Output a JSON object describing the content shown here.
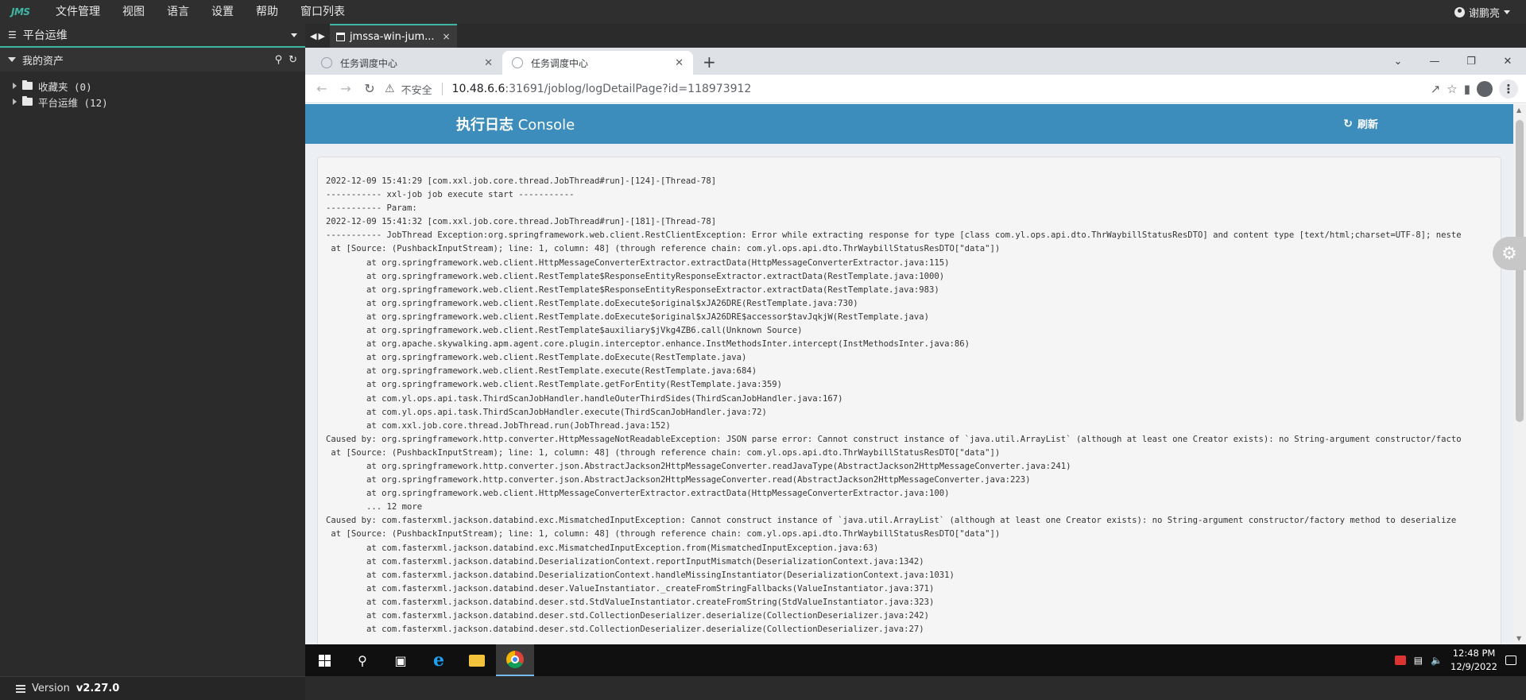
{
  "jms": {
    "logo": "JMS",
    "menu": [
      "文件管理",
      "视图",
      "语言",
      "设置",
      "帮助",
      "窗口列表"
    ],
    "user": "谢鹏亮"
  },
  "left_panel": {
    "header": "平台运维",
    "assets_title": "我的资产",
    "tree": [
      {
        "label": "收藏夹 (0)"
      },
      {
        "label": "平台运维 (12)"
      }
    ],
    "version_label": "Version",
    "version": "v2.27.0"
  },
  "session": {
    "tab_label": "jmssa-win-jum...",
    "close": "×"
  },
  "chrome": {
    "tabs": [
      {
        "title": "任务调度中心",
        "active": false
      },
      {
        "title": "任务调度中心",
        "active": true
      }
    ],
    "new_tab": "+",
    "security_text": "不安全",
    "url_host": "10.48.6.6",
    "url_path": ":31691/joblog/logDetailPage?id=118973912"
  },
  "page": {
    "title_bold": "执行日志",
    "title_rest": " Console",
    "refresh_label": "刷新",
    "log_lines": [
      "2022-12-09 15:41:29 [com.xxl.job.core.thread.JobThread#run]-[124]-[Thread-78]",
      "----------- xxl-job job execute start -----------",
      "----------- Param:",
      "2022-12-09 15:41:32 [com.xxl.job.core.thread.JobThread#run]-[181]-[Thread-78]",
      "----------- JobThread Exception:org.springframework.web.client.RestClientException: Error while extracting response for type [class com.yl.ops.api.dto.ThrWaybillStatusResDTO] and content type [text/html;charset=UTF-8]; neste",
      " at [Source: (PushbackInputStream); line: 1, column: 48] (through reference chain: com.yl.ops.api.dto.ThrWaybillStatusResDTO[\"data\"])",
      "        at org.springframework.web.client.HttpMessageConverterExtractor.extractData(HttpMessageConverterExtractor.java:115)",
      "        at org.springframework.web.client.RestTemplate$ResponseEntityResponseExtractor.extractData(RestTemplate.java:1000)",
      "        at org.springframework.web.client.RestTemplate$ResponseEntityResponseExtractor.extractData(RestTemplate.java:983)",
      "        at org.springframework.web.client.RestTemplate.doExecute$original$xJA26DRE(RestTemplate.java:730)",
      "        at org.springframework.web.client.RestTemplate.doExecute$original$xJA26DRE$accessor$tavJqkjW(RestTemplate.java)",
      "        at org.springframework.web.client.RestTemplate$auxiliary$jVkg4ZB6.call(Unknown Source)",
      "        at org.apache.skywalking.apm.agent.core.plugin.interceptor.enhance.InstMethodsInter.intercept(InstMethodsInter.java:86)",
      "        at org.springframework.web.client.RestTemplate.doExecute(RestTemplate.java)",
      "        at org.springframework.web.client.RestTemplate.execute(RestTemplate.java:684)",
      "        at org.springframework.web.client.RestTemplate.getForEntity(RestTemplate.java:359)",
      "        at com.yl.ops.api.task.ThirdScanJobHandler.handleOuterThirdSides(ThirdScanJobHandler.java:167)",
      "        at com.yl.ops.api.task.ThirdScanJobHandler.execute(ThirdScanJobHandler.java:72)",
      "        at com.xxl.job.core.thread.JobThread.run(JobThread.java:152)",
      "Caused by: org.springframework.http.converter.HttpMessageNotReadableException: JSON parse error: Cannot construct instance of `java.util.ArrayList` (although at least one Creator exists): no String-argument constructor/facto",
      " at [Source: (PushbackInputStream); line: 1, column: 48] (through reference chain: com.yl.ops.api.dto.ThrWaybillStatusResDTO[\"data\"])",
      "        at org.springframework.http.converter.json.AbstractJackson2HttpMessageConverter.readJavaType(AbstractJackson2HttpMessageConverter.java:241)",
      "        at org.springframework.http.converter.json.AbstractJackson2HttpMessageConverter.read(AbstractJackson2HttpMessageConverter.java:223)",
      "        at org.springframework.web.client.HttpMessageConverterExtractor.extractData(HttpMessageConverterExtractor.java:100)",
      "        ... 12 more",
      "Caused by: com.fasterxml.jackson.databind.exc.MismatchedInputException: Cannot construct instance of `java.util.ArrayList` (although at least one Creator exists): no String-argument constructor/factory method to deserialize",
      " at [Source: (PushbackInputStream); line: 1, column: 48] (through reference chain: com.yl.ops.api.dto.ThrWaybillStatusResDTO[\"data\"])",
      "        at com.fasterxml.jackson.databind.exc.MismatchedInputException.from(MismatchedInputException.java:63)",
      "        at com.fasterxml.jackson.databind.DeserializationContext.reportInputMismatch(DeserializationContext.java:1342)",
      "        at com.fasterxml.jackson.databind.DeserializationContext.handleMissingInstantiator(DeserializationContext.java:1031)",
      "        at com.fasterxml.jackson.databind.deser.ValueInstantiator._createFromStringFallbacks(ValueInstantiator.java:371)",
      "        at com.fasterxml.jackson.databind.deser.std.StdValueInstantiator.createFromString(StdValueInstantiator.java:323)",
      "        at com.fasterxml.jackson.databind.deser.std.CollectionDeserializer.deserialize(CollectionDeserializer.java:242)",
      "        at com.fasterxml.jackson.databind.deser.std.CollectionDeserializer.deserialize(CollectionDeserializer.java:27)"
    ]
  },
  "taskbar": {
    "time": "12:48 PM",
    "date": "12/9/2022"
  },
  "colors": {
    "accent": "#3fb6a3",
    "header_blue": "#3c8dbc"
  }
}
